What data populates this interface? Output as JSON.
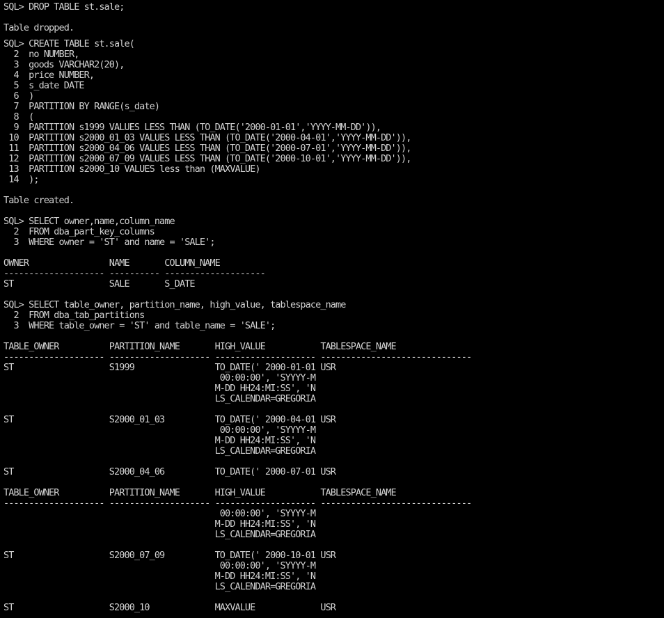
{
  "window": {
    "background": "#000000",
    "text_color": "#d2d2d2"
  },
  "terminal": {
    "lines": [
      {
        "text": "SQL> DROP TABLE st.sale;"
      },
      {
        "text": ""
      },
      {
        "text": "Table dropped."
      },
      {
        "text": "",
        "gap": true
      },
      {
        "text": "SQL> CREATE TABLE st.sale("
      },
      {
        "text": "  2  no NUMBER,"
      },
      {
        "text": "  3  goods VARCHAR2(20),"
      },
      {
        "text": "  4  price NUMBER,"
      },
      {
        "text": "  5  s_date DATE"
      },
      {
        "text": "  6  )"
      },
      {
        "text": "  7  PARTITION BY RANGE(s_date)"
      },
      {
        "text": "  8  ("
      },
      {
        "text": "  9  PARTITION s1999 VALUES LESS THAN (TO_DATE('2000-01-01','YYYY-MM-DD')),"
      },
      {
        "text": " 10  PARTITION s2000_01_03 VALUES LESS THAN (TO_DATE('2000-04-01','YYYY-MM-DD')),"
      },
      {
        "text": " 11  PARTITION s2000_04_06 VALUES LESS THAN (TO_DATE('2000-07-01','YYYY-MM-DD')),"
      },
      {
        "text": " 12  PARTITION s2000_07_09 VALUES LESS THAN (TO_DATE('2000-10-01','YYYY-MM-DD')),"
      },
      {
        "text": " 13  PARTITION s2000_10 VALUES less than (MAXVALUE)"
      },
      {
        "text": " 14  );"
      },
      {
        "text": ""
      },
      {
        "text": "Table created."
      },
      {
        "text": ""
      },
      {
        "text": "SQL> SELECT owner,name,column_name"
      },
      {
        "text": "  2  FROM dba_part_key_columns"
      },
      {
        "text": "  3  WHERE owner = 'ST' and name = 'SALE';"
      },
      {
        "text": ""
      },
      {
        "text": "OWNER                NAME       COLUMN_NAME"
      },
      {
        "text": "-------------------- ---------- --------------------"
      },
      {
        "text": "ST                   SALE       S_DATE"
      },
      {
        "text": ""
      },
      {
        "text": "SQL> SELECT table_owner, partition_name, high_value, tablespace_name"
      },
      {
        "text": "  2  FROM dba_tab_partitions"
      },
      {
        "text": "  3  WHERE table_owner = 'ST' and table_name = 'SALE';"
      },
      {
        "text": ""
      },
      {
        "text": "TABLE_OWNER          PARTITION_NAME       HIGH_VALUE           TABLESPACE_NAME"
      },
      {
        "text": "-------------------- -------------------- -------------------- ------------------------------"
      },
      {
        "text": "ST                   S1999                TO_DATE(' 2000-01-01 USR"
      },
      {
        "text": "                                           00:00:00', 'SYYYY-M"
      },
      {
        "text": "                                          M-DD HH24:MI:SS', 'N"
      },
      {
        "text": "                                          LS_CALENDAR=GREGORIA"
      },
      {
        "text": ""
      },
      {
        "text": "ST                   S2000_01_03          TO_DATE(' 2000-04-01 USR"
      },
      {
        "text": "                                           00:00:00', 'SYYYY-M"
      },
      {
        "text": "                                          M-DD HH24:MI:SS', 'N"
      },
      {
        "text": "                                          LS_CALENDAR=GREGORIA"
      },
      {
        "text": ""
      },
      {
        "text": "ST                   S2000_04_06          TO_DATE(' 2000-07-01 USR"
      },
      {
        "text": ""
      },
      {
        "text": "TABLE_OWNER          PARTITION_NAME       HIGH_VALUE           TABLESPACE_NAME"
      },
      {
        "text": "-------------------- -------------------- -------------------- ------------------------------"
      },
      {
        "text": "                                           00:00:00', 'SYYYY-M"
      },
      {
        "text": "                                          M-DD HH24:MI:SS', 'N"
      },
      {
        "text": "                                          LS_CALENDAR=GREGORIA"
      },
      {
        "text": ""
      },
      {
        "text": "ST                   S2000_07_09          TO_DATE(' 2000-10-01 USR"
      },
      {
        "text": "                                           00:00:00', 'SYYYY-M"
      },
      {
        "text": "                                          M-DD HH24:MI:SS', 'N"
      },
      {
        "text": "                                          LS_CALENDAR=GREGORIA"
      },
      {
        "text": ""
      },
      {
        "text": "ST                   S2000_10             MAXVALUE             USR"
      }
    ]
  }
}
